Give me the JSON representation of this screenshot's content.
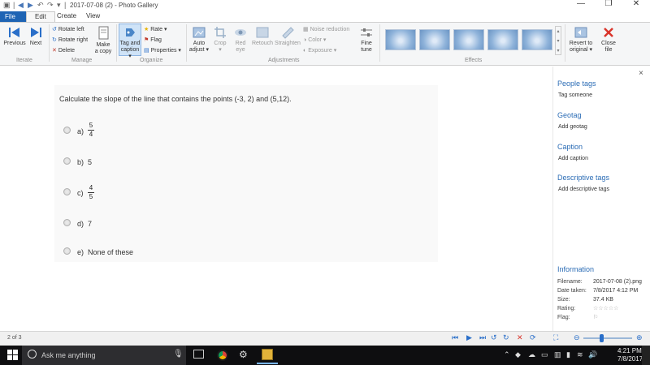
{
  "titlebar": {
    "title": "2017-07-08 (2) - Photo Gallery",
    "separator": "|"
  },
  "tabs": [
    "File",
    "Edit",
    "Create",
    "View"
  ],
  "ribbon": {
    "iterate": {
      "label": "Iterate",
      "previous": "Previous",
      "next": "Next"
    },
    "manage": {
      "label": "Manage",
      "rotate_left": "Rotate left",
      "rotate_right": "Rotate right",
      "delete": "Delete",
      "make_copy_1": "Make",
      "make_copy_2": "a copy"
    },
    "organize": {
      "label": "Organize",
      "tag_caption_1": "Tag and",
      "tag_caption_2": "caption ▾",
      "rate": "Rate ▾",
      "flag": "Flag",
      "properties": "Properties ▾"
    },
    "adjustments": {
      "label": "Adjustments",
      "auto_adjust_1": "Auto",
      "auto_adjust_2": "adjust ▾",
      "crop": "Crop",
      "red_eye_1": "Red",
      "red_eye_2": "eye",
      "retouch": "Retouch",
      "straighten": "Straighten",
      "noise": "Noise reduction",
      "color": "Color ▾",
      "exposure": "Exposure ▾",
      "fine_tune_1": "Fine",
      "fine_tune_2": "tune"
    },
    "effects": {
      "label": "Effects"
    },
    "revert_1": "Revert to",
    "revert_2": "original ▾",
    "close_1": "Close",
    "close_2": "file"
  },
  "question": {
    "text": "Calculate the slope of the line that contains the points (-3, 2) and (5,12).",
    "options": [
      {
        "letter": "a)",
        "num": "5",
        "den": "4"
      },
      {
        "letter": "b)",
        "value": "5"
      },
      {
        "letter": "c)",
        "num": "4",
        "den": "5"
      },
      {
        "letter": "d)",
        "value": "7"
      },
      {
        "letter": "e)",
        "value": "None of these"
      }
    ]
  },
  "side": {
    "close": "×",
    "people_tags": "People tags",
    "tag_someone": "Tag someone",
    "geotag": "Geotag",
    "add_geotag": "Add geotag",
    "caption": "Caption",
    "add_caption": "Add caption",
    "descriptive_tags": "Descriptive tags",
    "add_descriptive_tags": "Add descriptive tags",
    "information": "Information",
    "info": [
      {
        "key": "Filename:",
        "value": "2017-07-08 (2).png"
      },
      {
        "key": "Date taken:",
        "value": "7/8/2017   4:12 PM"
      },
      {
        "key": "Size:",
        "value": "37.4 KB"
      },
      {
        "key": "Rating:",
        "value": "☆☆☆☆☆"
      },
      {
        "key": "Flag:",
        "value": "⚐"
      }
    ]
  },
  "status": {
    "position": "2 of 3"
  },
  "taskbar": {
    "search_placeholder": "Ask me anything",
    "time": "4:21 PM",
    "date": "7/8/2017"
  }
}
